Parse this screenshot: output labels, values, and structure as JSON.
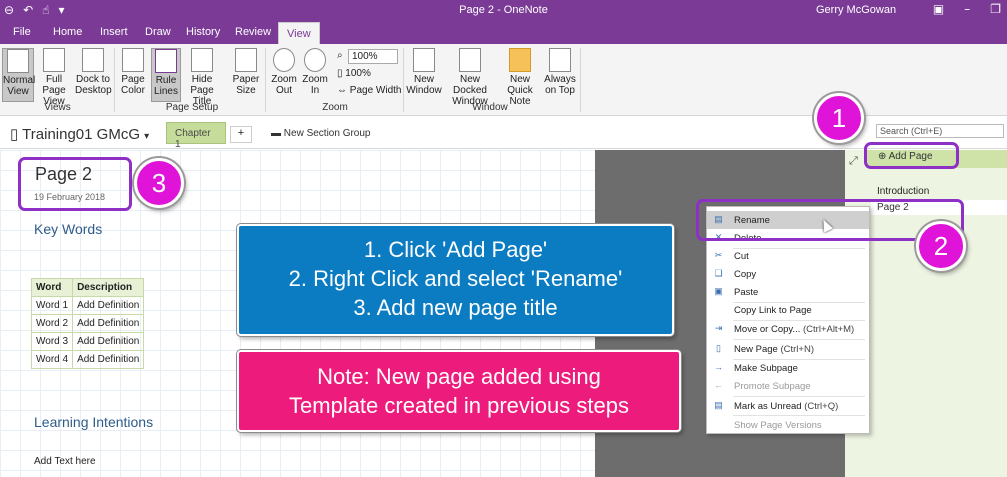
{
  "window": {
    "title": "Page 2 - OneNote",
    "user": "Gerry McGowan"
  },
  "tabs": [
    "File",
    "Home",
    "Insert",
    "Draw",
    "History",
    "Review",
    "View"
  ],
  "ribbon": {
    "views": {
      "label": "Views",
      "normal": "Normal View",
      "full": "Full Page View",
      "dock": "Dock to Desktop"
    },
    "page_setup": {
      "label": "Page Setup",
      "color": "Page Color",
      "rule": "Rule Lines",
      "hide": "Hide Page Title",
      "paper": "Paper Size"
    },
    "zoom": {
      "label": "Zoom",
      "out": "Zoom Out",
      "in": "Zoom In",
      "value": "100%",
      "hundred": "100%",
      "width": "Page Width"
    },
    "window": {
      "label": "Window",
      "new": "New Window",
      "docked": "New Docked Window",
      "quick": "New Quick Note",
      "top": "Always on Top"
    }
  },
  "notebook": {
    "name": "Training01 GMcG",
    "section": "Chapter 1",
    "plus": "+",
    "new_group": "New Section Group",
    "search_placeholder": "Search (Ctrl+E)"
  },
  "page": {
    "title": "Page 2",
    "date": "19 February 2018",
    "heading_key": "Key Words",
    "table": {
      "headers": [
        "Word",
        "Description"
      ],
      "rows": [
        [
          "Word 1",
          "Add Definition"
        ],
        [
          "Word 2",
          "Add Definition"
        ],
        [
          "Word 3",
          "Add Definition"
        ],
        [
          "Word 4",
          "Add Definition"
        ]
      ]
    },
    "heading_learn": "Learning Intentions",
    "add_text": "Add Text here"
  },
  "pages_pane": {
    "add_page": "Add Page",
    "items": [
      "Introduction",
      "Page 2"
    ]
  },
  "context_menu": [
    {
      "label": "Rename",
      "shortcut": ""
    },
    {
      "label": "Delete",
      "shortcut": ""
    },
    {
      "label": "Cut",
      "shortcut": ""
    },
    {
      "label": "Copy",
      "shortcut": ""
    },
    {
      "label": "Paste",
      "shortcut": ""
    },
    {
      "label": "Copy Link to Page",
      "shortcut": ""
    },
    {
      "label": "Move or Copy...",
      "shortcut": "(Ctrl+Alt+M)"
    },
    {
      "label": "New Page",
      "shortcut": "(Ctrl+N)"
    },
    {
      "label": "Make Subpage",
      "shortcut": ""
    },
    {
      "label": "Promote Subpage",
      "shortcut": ""
    },
    {
      "label": "Mark as Unread",
      "shortcut": "(Ctrl+Q)"
    },
    {
      "label": "Show Page Versions",
      "shortcut": ""
    }
  ],
  "callouts": {
    "step1": "1",
    "step2": "2",
    "step3": "3",
    "instructions": [
      "1. Click 'Add Page'",
      "2. Right Click and select 'Rename'",
      "3. Add new page title"
    ],
    "note": [
      "Note: New page added using",
      "Template created in previous steps"
    ]
  },
  "colors": {
    "titlebar": "#7a3a96",
    "callout_circle": "#e014d8",
    "highlight_border": "#8e2fc6",
    "blue_box": "#0b7cc2",
    "pink_box": "#ed1b7b"
  }
}
